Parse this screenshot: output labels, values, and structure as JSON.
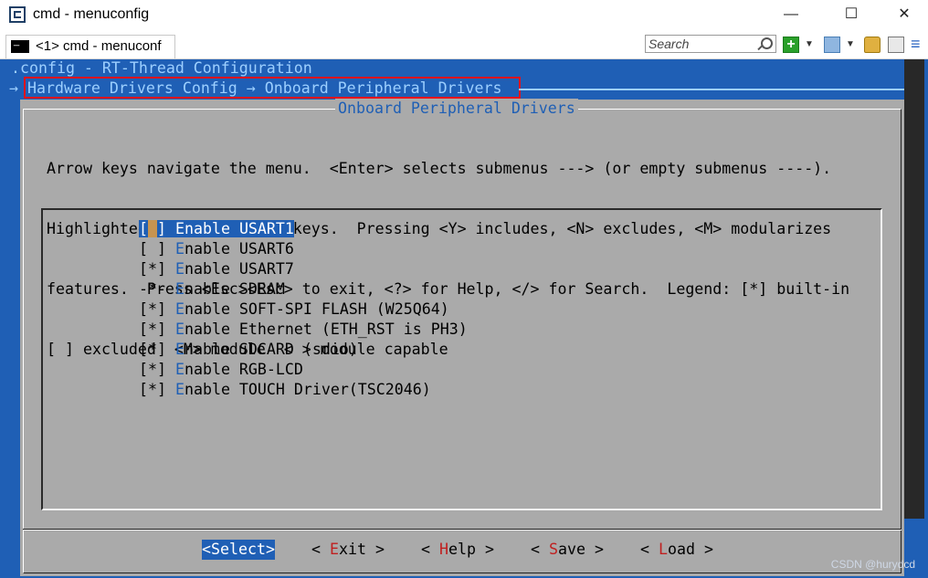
{
  "window": {
    "title": "cmd - menuconfig",
    "minimize": "—",
    "maximize": "☐",
    "close": "✕"
  },
  "tabbar": {
    "tab_label": "<1> cmd - menuconf",
    "search_placeholder": "Search",
    "plus_label": "+",
    "dropdown_glyph": "▼",
    "menu_glyph": "≡"
  },
  "console": {
    "config_title": ".config - RT-Thread Configuration",
    "breadcrumb_arrow": "→",
    "breadcrumb": "Hardware Drivers Config → Onboard Peripheral Drivers"
  },
  "dialog": {
    "title": "Onboard Peripheral Drivers",
    "help_lines": [
      "Arrow keys navigate the menu.  <Enter> selects submenus ---> (or empty submenus ----).",
      "Highlighted letters are hotkeys.  Pressing <Y> includes, <N> excludes, <M> modularizes",
      "features.  Press <Esc><Esc> to exit, <?> for Help, </> for Search.  Legend: [*] built-in",
      "[ ] excluded  <M> module  < > module capable"
    ],
    "items": [
      {
        "state": "[ ]",
        "hotkey": "E",
        "rest": "nable USART1",
        "selected": true
      },
      {
        "state": "[ ]",
        "hotkey": "E",
        "rest": "nable USART6",
        "selected": false
      },
      {
        "state": "[*]",
        "hotkey": "E",
        "rest": "nable USART7",
        "selected": false
      },
      {
        "state": "-*-",
        "hotkey": "E",
        "rest": "nable SDRAM",
        "selected": false
      },
      {
        "state": "[*]",
        "hotkey": "E",
        "rest": "nable SOFT-SPI FLASH (W25Q64)",
        "selected": false
      },
      {
        "state": "[*]",
        "hotkey": "E",
        "rest": "nable Ethernet (ETH_RST is PH3)",
        "selected": false
      },
      {
        "state": "[*]",
        "hotkey": "E",
        "rest": "nable SDCARD (sdio)",
        "selected": false
      },
      {
        "state": "[*]",
        "hotkey": "E",
        "rest": "nable RGB-LCD",
        "selected": false
      },
      {
        "state": "[*]",
        "hotkey": "E",
        "rest": "nable TOUCH Driver(TSC2046)",
        "selected": false
      }
    ],
    "buttons": [
      {
        "pre": "<",
        "hot": "S",
        "rest": "elect",
        "post": ">"
      },
      {
        "pre": "< ",
        "hot": "E",
        "rest": "xit",
        "post": " >"
      },
      {
        "pre": "< ",
        "hot": "H",
        "rest": "elp",
        "post": " >"
      },
      {
        "pre": "< ",
        "hot": "S",
        "rest": "ave",
        "post": " >"
      },
      {
        "pre": "< ",
        "hot": "L",
        "rest": "oad",
        "post": " >"
      }
    ]
  },
  "watermark": "CSDN @hurydcd",
  "colors": {
    "console_bg": "#1f5fb5",
    "dialog_bg": "#aaaaaa",
    "highlight": "#1f5fb5",
    "breadcrumb_box": "#e8131b"
  }
}
